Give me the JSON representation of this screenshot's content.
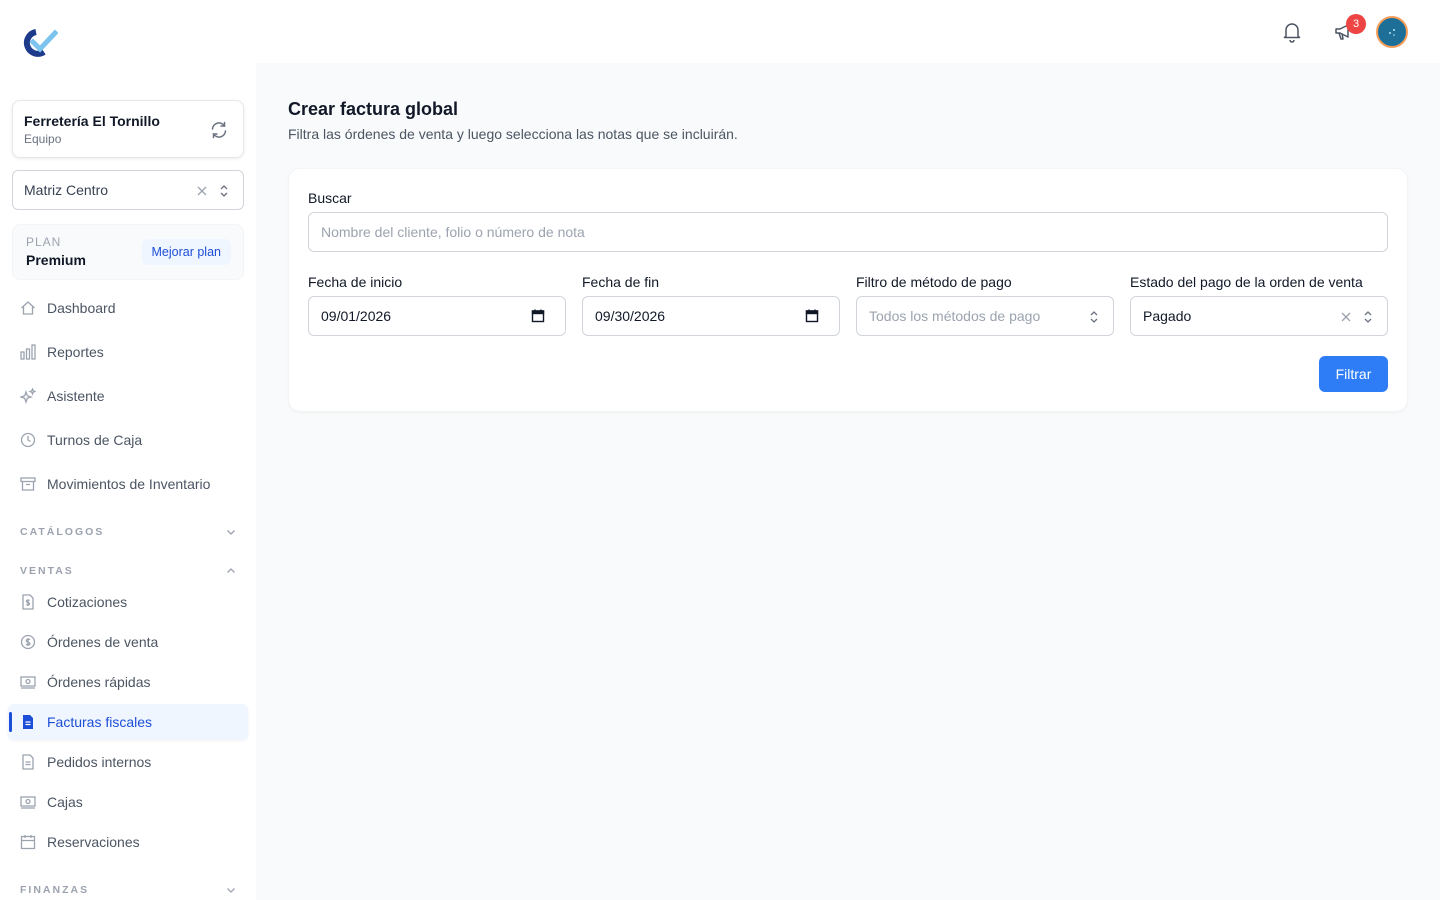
{
  "sidebar": {
    "team": {
      "name": "Ferretería El Tornillo",
      "role": "Equipo"
    },
    "branch": {
      "value": "Matriz Centro"
    },
    "plan": {
      "label": "PLAN",
      "name": "Premium",
      "upgrade": "Mejorar plan"
    },
    "nav": [
      {
        "label": "Dashboard",
        "icon": "home-icon"
      },
      {
        "label": "Reportes",
        "icon": "chart-bar-icon"
      },
      {
        "label": "Asistente",
        "icon": "sparkles-icon"
      },
      {
        "label": "Turnos de Caja",
        "icon": "clock-icon"
      },
      {
        "label": "Movimientos de Inventario",
        "icon": "archive-box-icon"
      }
    ],
    "sections": {
      "catalogos": "CATÁLOGOS",
      "ventas": "VENTAS",
      "finanzas": "FINANZAS"
    },
    "ventas_items": [
      {
        "label": "Cotizaciones",
        "icon": "document-dollar-icon"
      },
      {
        "label": "Órdenes de venta",
        "icon": "currency-circle-icon"
      },
      {
        "label": "Órdenes rápidas",
        "icon": "banknotes-icon"
      },
      {
        "label": "Facturas fiscales",
        "icon": "document-text-icon",
        "active": true
      },
      {
        "label": "Pedidos internos",
        "icon": "document-icon"
      },
      {
        "label": "Cajas",
        "icon": "cash-register-icon"
      },
      {
        "label": "Reservaciones",
        "icon": "calendar-icon"
      }
    ]
  },
  "topbar": {
    "notifications_badge": "3"
  },
  "main": {
    "title": "Crear factura global",
    "subtitle": "Filtra las órdenes de venta y luego selecciona las notas que se incluirán.",
    "search": {
      "label": "Buscar",
      "placeholder": "Nombre del cliente, folio o número de nota"
    },
    "start_date": {
      "label": "Fecha de inicio",
      "value": "09/01/2026"
    },
    "end_date": {
      "label": "Fecha de fin",
      "value": "09/30/2026"
    },
    "payment_method": {
      "label": "Filtro de método de pago",
      "placeholder": "Todos los métodos de pago"
    },
    "payment_status": {
      "label": "Estado del pago de la orden de venta",
      "value": "Pagado"
    },
    "filter_button": "Filtrar"
  },
  "colors": {
    "accent": "#2f7df6",
    "active_text": "#1d4ed8",
    "badge": "#ef4444"
  }
}
